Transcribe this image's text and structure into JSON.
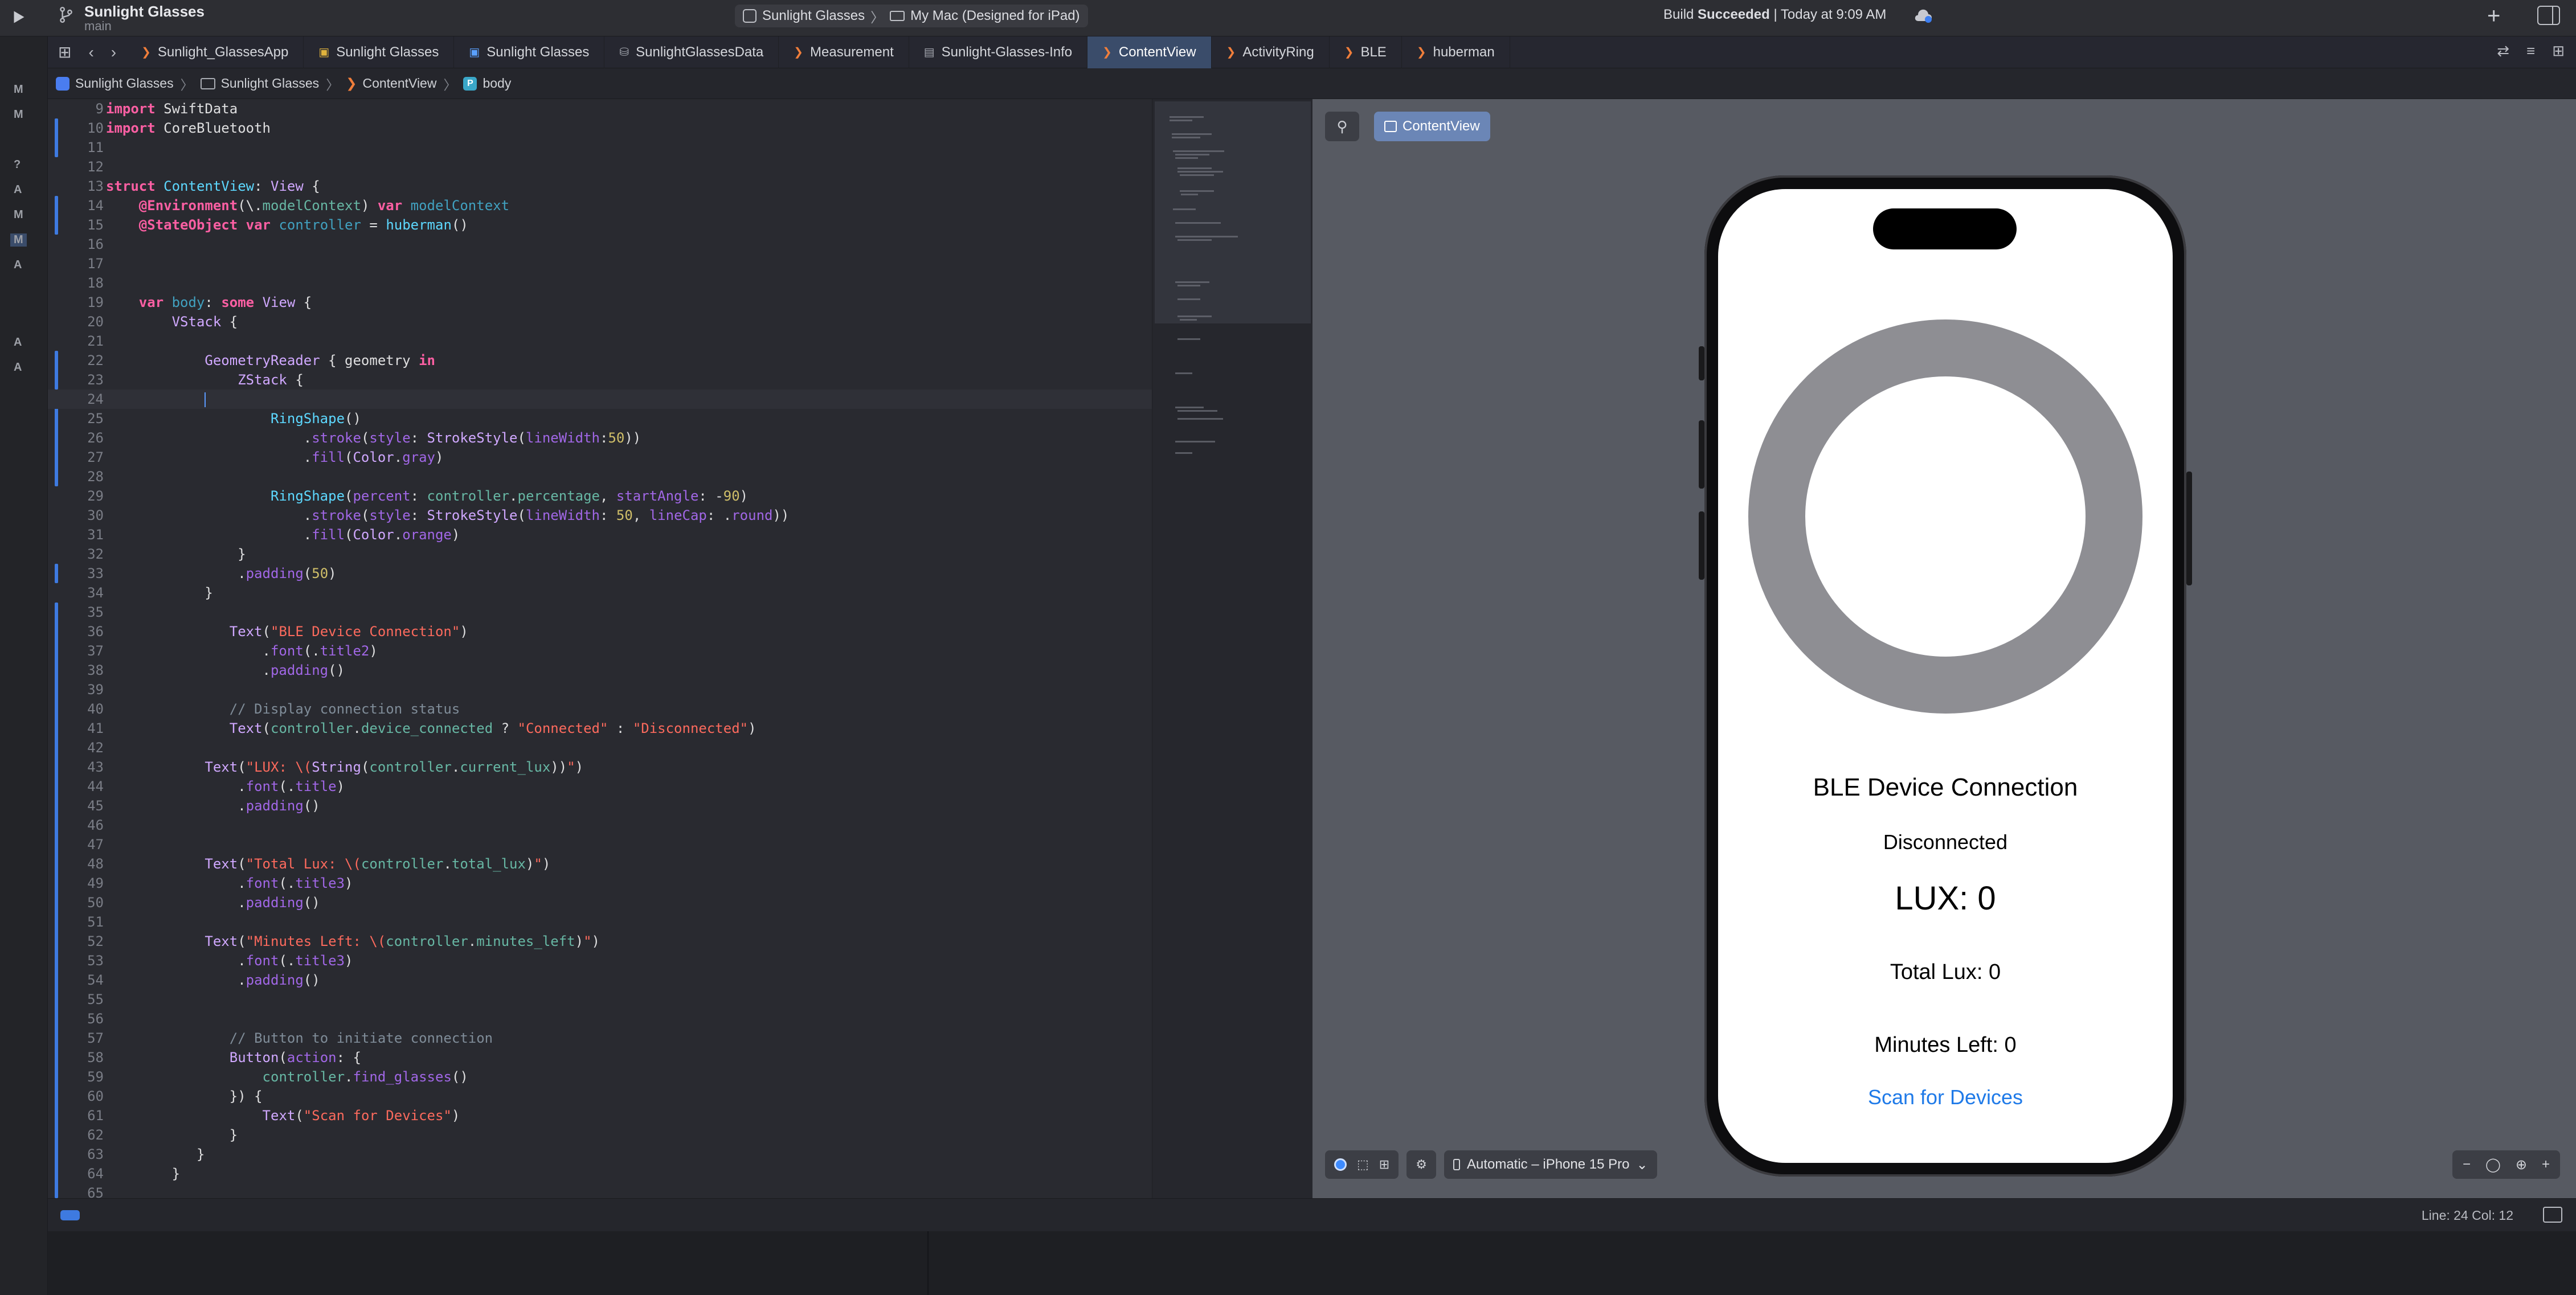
{
  "window": {
    "project_name": "Sunlight Glasses",
    "branch": "main",
    "scheme_target": "Sunlight Glasses",
    "scheme_destination": "My Mac (Designed for iPad)",
    "build_status_prefix": "Build",
    "build_status_word": "Succeeded",
    "build_status_time": "| Today at 9:09 AM"
  },
  "sidebar_marks": [
    "M",
    "M",
    "?",
    "A",
    "M",
    "M",
    "A",
    "A",
    "A"
  ],
  "tabs": [
    {
      "label": "Sunlight_GlassesApp",
      "icon": "swift-file-icon"
    },
    {
      "label": "Sunlight Glasses",
      "icon": "asset-icon"
    },
    {
      "label": "Sunlight Glasses",
      "icon": "project-icon"
    },
    {
      "label": "SunlightGlassesData",
      "icon": "data-model-icon"
    },
    {
      "label": "Measurement",
      "icon": "swift-file-icon"
    },
    {
      "label": "Sunlight-Glasses-Info",
      "icon": "plist-icon"
    },
    {
      "label": "ContentView",
      "icon": "swift-file-icon",
      "active": true
    },
    {
      "label": "ActivityRing",
      "icon": "swift-file-icon"
    },
    {
      "label": "BLE",
      "icon": "swift-file-icon"
    },
    {
      "label": "huberman",
      "icon": "swift-file-icon"
    }
  ],
  "breadcrumb": {
    "project": "Sunlight Glasses",
    "folder": "Sunlight Glasses",
    "file": "ContentView",
    "symbol_badge": "P",
    "symbol": "body"
  },
  "code": {
    "line_numbers": [
      "9",
      "10",
      "11",
      "12",
      "13",
      "14",
      "15",
      "16",
      "17",
      "18",
      "19",
      "20",
      "21",
      "22",
      "23",
      "24",
      "25",
      "26",
      "27",
      "28",
      "29",
      "30",
      "31",
      "32",
      "33",
      "34",
      "35",
      "36",
      "37",
      "38",
      "39",
      "40",
      "41",
      "42",
      "43",
      "44",
      "45",
      "46",
      "47",
      "48",
      "49",
      "50",
      "51",
      "52",
      "53",
      "54",
      "55",
      "56",
      "57",
      "58",
      "59",
      "60",
      "61",
      "62",
      "63",
      "64",
      "65"
    ],
    "current_line": "24"
  },
  "preview": {
    "pin_icon": "pin-icon",
    "chip_label": "ContentView",
    "title": "BLE Device Connection",
    "status": "Disconnected",
    "lux": "LUX: 0",
    "total_lux": "Total Lux: 0",
    "minutes_left": "Minutes Left: 0",
    "scan_button": "Scan for Devices",
    "device_select": "Automatic – iPhone 15 Pro",
    "ring_colors": {
      "track": "#8e8e93",
      "progress": "#ff9500"
    },
    "ring_percentage": 0
  },
  "statusbar": {
    "cursor_position": "Line: 24  Col: 12"
  }
}
